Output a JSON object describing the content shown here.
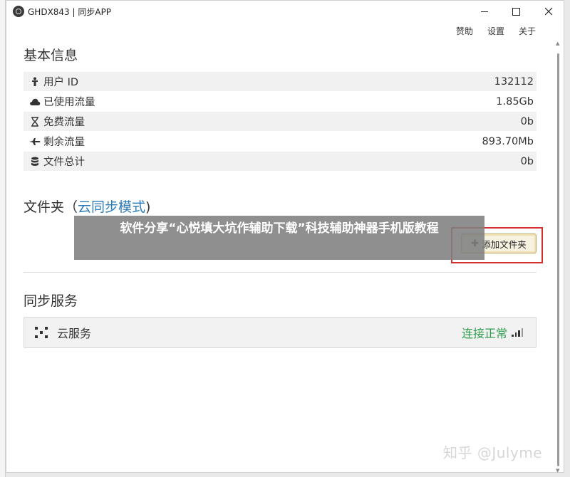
{
  "window": {
    "title": "GHDX843 | 同步APP"
  },
  "menu": {
    "donate": "赞助",
    "settings": "设置",
    "about": "关于"
  },
  "basic_info": {
    "title": "基本信息",
    "rows": [
      {
        "icon": "person-icon",
        "label": "用户 ID",
        "value": "132112"
      },
      {
        "icon": "cloud-icon",
        "label": "已使用流量",
        "value": "1.85Gb"
      },
      {
        "icon": "hourglass-icon",
        "label": "免费流量",
        "value": "0b"
      },
      {
        "icon": "plane-icon",
        "label": "剩余流量",
        "value": "893.70Mb"
      },
      {
        "icon": "database-icon",
        "label": "文件总计",
        "value": "0b"
      }
    ]
  },
  "folders": {
    "title": "文件夹",
    "mode_open": "（",
    "mode": "云同步模式",
    "mode_close": ")",
    "add_button": "添加文件夹"
  },
  "sync_service": {
    "title": "同步服务",
    "service_name": "云服务",
    "status": "连接正常"
  },
  "overlay": {
    "banner": "软件分享“心悦填大坑作辅助下载”科技辅助神器手机版教程",
    "watermark": "知乎 @Julyme"
  },
  "colors": {
    "status_ok": "#2e9c4c",
    "mode_link": "#2b7bb9",
    "highlight": "#d3302f"
  }
}
